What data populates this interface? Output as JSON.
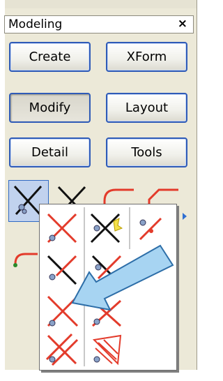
{
  "panel": {
    "title": "Modeling",
    "close_label": "×"
  },
  "categories": {
    "create": "Create",
    "xform": "XForm",
    "modify": "Modify",
    "layout": "Layout",
    "detail": "Detail",
    "tools": "Tools"
  },
  "colors": {
    "button_border": "#2f5bb7",
    "selection": "#c1d2ee",
    "cross_red": "#e33b2b",
    "arrow_fill": "#a7d4f2",
    "arrow_stroke": "#2d6ea8"
  },
  "toolbar_icons": [
    "trim-icon",
    "trim-icon",
    "fillet-icon",
    "chamfer-icon"
  ],
  "flyout_icons": [
    "trim-icon",
    "trim-multiple-icon",
    "extend-icon",
    "trim-extend-icon",
    "trim-corner-icon",
    "trim-intersect-icon",
    "trim-quick-icon",
    "offset-trim-icon",
    "hatch-trim-icon"
  ]
}
